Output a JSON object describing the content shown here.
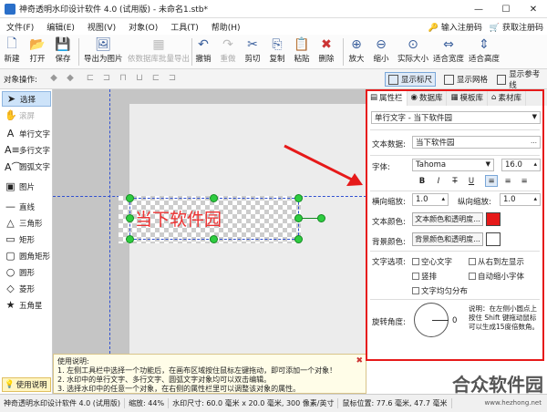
{
  "window": {
    "title": "神奇透明水印设计软件 4.0 (试用版) - 未命名1.stb*"
  },
  "menu": {
    "items": [
      "文件(F)",
      "编辑(E)",
      "视图(V)",
      "对象(O)",
      "工具(T)",
      "帮助(H)"
    ],
    "right": [
      "输入注册码",
      "获取注册码"
    ]
  },
  "toolbar": {
    "new": "新建",
    "open": "打开",
    "save": "保存",
    "export_image": "导出为图片",
    "batch": "依数据库批量导出",
    "undo": "撤销",
    "redo": "重做",
    "cut": "剪切",
    "copy": "复制",
    "paste": "粘贴",
    "delete": "删除",
    "zoom_in": "放大",
    "zoom_out": "缩小",
    "actual": "实际大小",
    "fit_width": "适合宽度",
    "fit_height": "适合高度"
  },
  "objbar": {
    "label": "对象操作:",
    "ruler": "显示标尺",
    "grid": "显示网格",
    "guides": "显示参考线"
  },
  "tools": [
    "选择",
    "滚屏",
    "单行文字",
    "多行文字",
    "圆弧文字",
    "图片",
    "直线",
    "三角形",
    "矩形",
    "圆角矩形",
    "圆形",
    "菱形",
    "五角星"
  ],
  "usage": "使用说明",
  "canvas": {
    "text": "当下软件园"
  },
  "help": {
    "title": "使用说明:",
    "lines": [
      "1. 左侧工具栏中选择一个功能后，在画布区域按住鼠标左键拖动，即可添加一个对象！",
      "2. 水印中的单行文字、多行文字、圆弧文字对象均可以双击编辑。",
      "3. 选择水印中的任意一个对象，在右侧的属性栏里可以调整该对象的属性。"
    ]
  },
  "panel": {
    "tabs": [
      "属性栏",
      "数据库",
      "模板库",
      "素材库"
    ],
    "object_select": "单行文字 - 当下软件园",
    "text_data_label": "文本数据:",
    "text_data_value": "当下软件园",
    "font_label": "字体:",
    "font_value": "Tahoma",
    "font_size": "16.0",
    "hscale_label": "横向缩放:",
    "hscale": "1.0",
    "vscale_label": "纵向缩放:",
    "vscale": "1.0",
    "text_color_label": "文本颜色:",
    "text_color_btn": "文本颜色和透明度...",
    "bg_color_label": "背景颜色:",
    "bg_color_btn": "背景颜色和透明度...",
    "options_label": "文字选项:",
    "opt_hollow": "空心文字",
    "opt_rtl": "从右到左显示",
    "opt_vertical": "竖排",
    "opt_autoshrink": "自动缩小字体",
    "opt_even": "文字均匀分布",
    "rotate_label": "旋转角度:",
    "rotate_value": "0",
    "rotate_help": "说明：在左侧小圆点上按住 Shift 键拖动鼠标可以生成15度倍数角。",
    "text_color": "#e61919",
    "bg_color": "#ffffff"
  },
  "status": [
    "神奇透明水印设计软件 4.0 (试用版)",
    "缩放: 44%",
    "水印尺寸: 60.0 毫米 x 20.0 毫米, 300 像素/英寸",
    "鼠标位置: 77.6 毫米, 47.7 毫米"
  ],
  "watermark": {
    "main": "合众软件园",
    "url": "www.hezhong.net"
  }
}
